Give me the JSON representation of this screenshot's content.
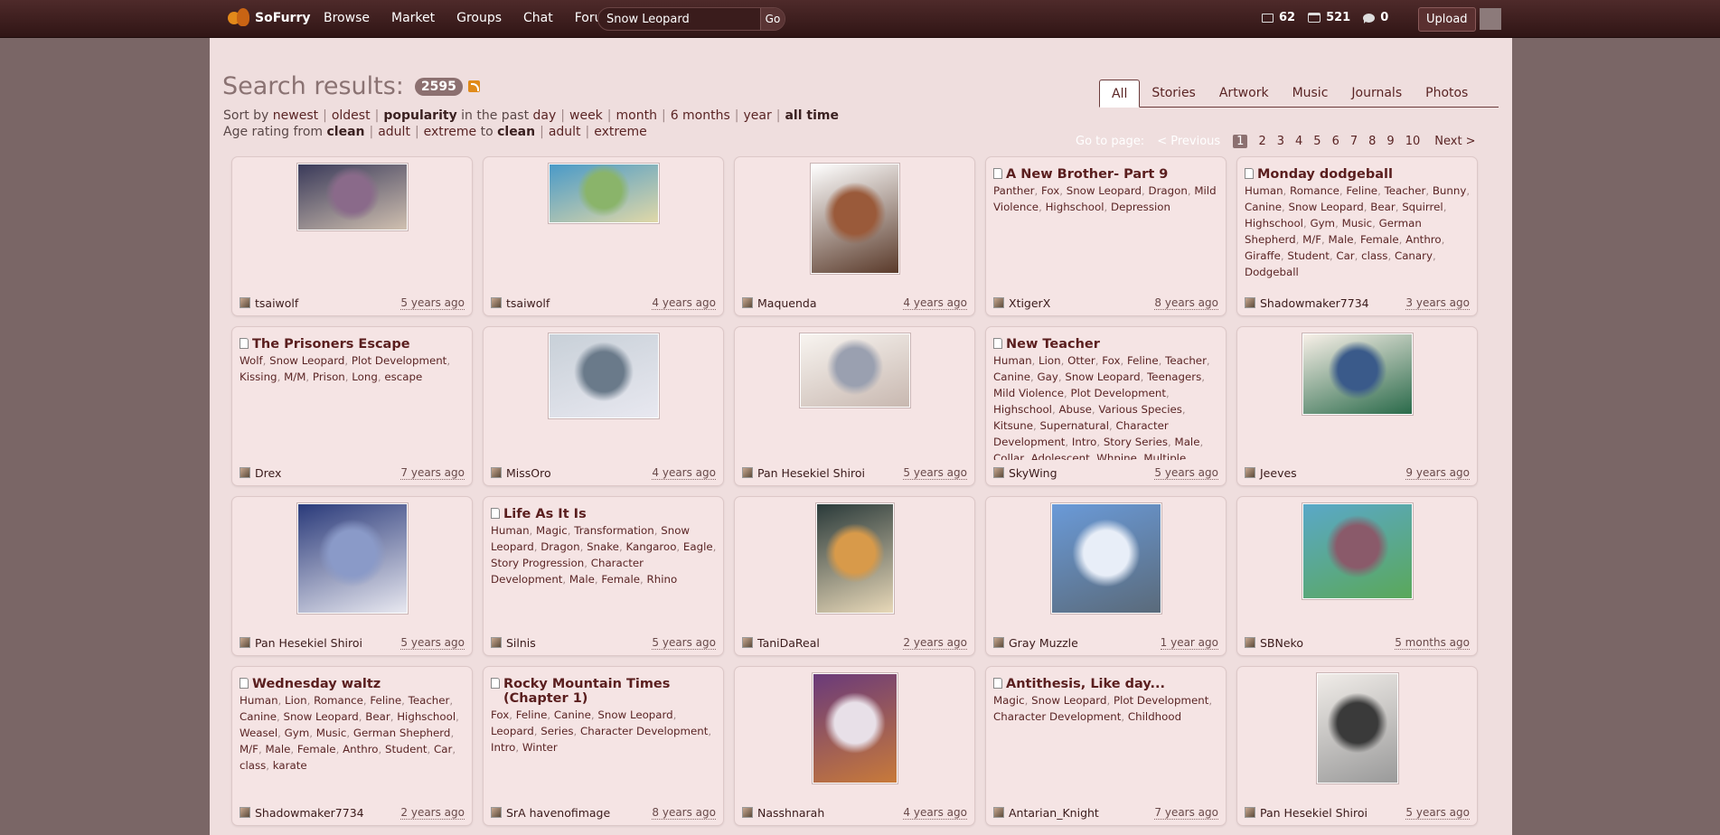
{
  "header": {
    "logo_text": "SoFurry",
    "nav": [
      "Browse",
      "Market",
      "Groups",
      "Chat",
      "Forum"
    ],
    "search_value": "Snow Leopard",
    "go_label": "Go",
    "stats": {
      "submissions": "62",
      "messages": "521",
      "comments": "0"
    },
    "upload_label": "Upload"
  },
  "search": {
    "title": "Search results:",
    "count": "2595"
  },
  "tabs": [
    "All",
    "Stories",
    "Artwork",
    "Music",
    "Journals",
    "Photos"
  ],
  "sort": {
    "prefix": "Sort by",
    "newest": "newest",
    "oldest": "oldest",
    "popularity": "popularity",
    "in_the_past": "in the past",
    "periods": [
      "day",
      "week",
      "month",
      "6 months",
      "year",
      "all time"
    ]
  },
  "age": {
    "prefix": "Age rating from",
    "from": [
      "clean",
      "adult",
      "extreme"
    ],
    "to_word": "to",
    "to": [
      "clean",
      "adult",
      "extreme"
    ]
  },
  "pager": {
    "label": "Go to page:",
    "prev": "< Previous",
    "pages": [
      "1",
      "2",
      "3",
      "4",
      "5",
      "6",
      "7",
      "8",
      "9",
      "10"
    ],
    "current": "1",
    "next": "Next >"
  },
  "results": [
    {
      "type": "art",
      "user": "tsaiwolf",
      "ago": "5 years ago",
      "tw": "124",
      "th": "76",
      "colors": [
        "#3a3a5a",
        "#8a6a8a",
        "#d0c0b0"
      ]
    },
    {
      "type": "art",
      "user": "tsaiwolf",
      "ago": "4 years ago",
      "tw": "124",
      "th": "68",
      "colors": [
        "#4a9ac8",
        "#8ab46a",
        "#e0d8a8"
      ]
    },
    {
      "type": "art",
      "user": "Maquenda",
      "ago": "4 years ago",
      "tw": "100",
      "th": "124",
      "colors": [
        "#ffffff",
        "#9a5a3a",
        "#5a3a2a"
      ]
    },
    {
      "type": "story",
      "title": "A New Brother- Part 9",
      "tags": [
        "Panther",
        "Fox",
        "Snow Leopard",
        "Dragon",
        "Mild Violence",
        "Highschool",
        "Depression"
      ],
      "user": "XtigerX",
      "ago": "8 years ago"
    },
    {
      "type": "story",
      "title": "Monday dodgeball",
      "tags": [
        "Human",
        "Romance",
        "Feline",
        "Teacher",
        "Bunny",
        "Canine",
        "Snow Leopard",
        "Bear",
        "Squirrel",
        "Highschool",
        "Gym",
        "Music",
        "German Shepherd",
        "M/F",
        "Male",
        "Female",
        "Anthro",
        "Giraffe",
        "Student",
        "Car",
        "class",
        "Canary",
        "Dodgeball"
      ],
      "user": "Shadowmaker7734",
      "ago": "3 years ago"
    },
    {
      "type": "story",
      "title": "The Prisoners Escape",
      "tags": [
        "Wolf",
        "Snow Leopard",
        "Plot Development",
        "Kissing",
        "M/M",
        "Prison",
        "Long",
        "escape"
      ],
      "user": "Drex",
      "ago": "7 years ago"
    },
    {
      "type": "art",
      "user": "MissOro",
      "ago": "4 years ago",
      "tw": "124",
      "th": "96",
      "colors": [
        "#c8d0d8",
        "#6a7a8a",
        "#e8e8f0"
      ]
    },
    {
      "type": "art",
      "user": "Pan Hesekiel Shiroi",
      "ago": "5 years ago",
      "tw": "124",
      "th": "84",
      "colors": [
        "#f8f4f0",
        "#9aa0b0",
        "#c8b8b0"
      ]
    },
    {
      "type": "story",
      "title": "New Teacher",
      "tags": [
        "Human",
        "Lion",
        "Otter",
        "Fox",
        "Feline",
        "Teacher",
        "Canine",
        "Gay",
        "Snow Leopard",
        "Teenagers",
        "Mild Violence",
        "Plot Development",
        "Highschool",
        "Abuse",
        "Various Species",
        "Kitsune",
        "Supernatural",
        "Character Development",
        "Intro",
        "Story Series",
        "Male",
        "Collar",
        "Adolescent",
        "Whpine",
        "Multiple"
      ],
      "user": "SkyWing",
      "ago": "5 years ago"
    },
    {
      "type": "art",
      "user": "Jeeves",
      "ago": "9 years ago",
      "tw": "124",
      "th": "92",
      "colors": [
        "#f8f0e8",
        "#3a5a8a",
        "#2a6a4a"
      ]
    },
    {
      "type": "art",
      "user": "Pan Hesekiel Shiroi",
      "ago": "5 years ago",
      "tw": "124",
      "th": "124",
      "colors": [
        "#2a3a7a",
        "#8a9ac8",
        "#e8e8f0"
      ]
    },
    {
      "type": "story",
      "title": "Life As It Is",
      "tags": [
        "Human",
        "Magic",
        "Transformation",
        "Snow Leopard",
        "Dragon",
        "Snake",
        "Kangaroo",
        "Eagle",
        "Story Progression",
        "Character Development",
        "Male",
        "Female",
        "Rhino"
      ],
      "user": "Silnis",
      "ago": "5 years ago"
    },
    {
      "type": "art",
      "user": "TaniDaReal",
      "ago": "2 years ago",
      "tw": "88",
      "th": "124",
      "colors": [
        "#2a3a3a",
        "#d89a4a",
        "#e8d8b8"
      ]
    },
    {
      "type": "art",
      "user": "Gray Muzzle",
      "ago": "1 year ago",
      "tw": "124",
      "th": "124",
      "colors": [
        "#6a9ad8",
        "#e8eef8",
        "#5a6a7a"
      ]
    },
    {
      "type": "art",
      "user": "SBNeko",
      "ago": "5 months ago",
      "tw": "124",
      "th": "108",
      "colors": [
        "#5aa8c8",
        "#8a5a6a",
        "#5aa85a"
      ]
    },
    {
      "type": "story",
      "title": "Wednesday waltz",
      "tags": [
        "Human",
        "Lion",
        "Romance",
        "Feline",
        "Teacher",
        "Canine",
        "Snow Leopard",
        "Bear",
        "Highschool",
        "Weasel",
        "Gym",
        "Music",
        "German Shepherd",
        "M/F",
        "Male",
        "Female",
        "Anthro",
        "Student",
        "Car",
        "class",
        "karate"
      ],
      "user": "Shadowmaker7734",
      "ago": "2 years ago"
    },
    {
      "type": "story",
      "title": "Rocky Mountain Times (Chapter 1)",
      "tags": [
        "Fox",
        "Feline",
        "Canine",
        "Snow Leopard",
        "Leopard",
        "Series",
        "Character Development",
        "Intro",
        "Winter"
      ],
      "user": "SrA havenofimage",
      "ago": "8 years ago"
    },
    {
      "type": "art",
      "user": "Nasshnarah",
      "ago": "4 years ago",
      "tw": "96",
      "th": "124",
      "colors": [
        "#6a3a7a",
        "#e8e0e8",
        "#c87a3a"
      ]
    },
    {
      "type": "story",
      "title": "Antithesis, Like day...",
      "tags": [
        "Magic",
        "Snow Leopard",
        "Plot Development",
        "Character Development",
        "Childhood"
      ],
      "user": "Antarian_Knight",
      "ago": "7 years ago"
    },
    {
      "type": "art",
      "user": "Pan Hesekiel Shiroi",
      "ago": "5 years ago",
      "tw": "92",
      "th": "124",
      "colors": [
        "#f0ece8",
        "#3a3a3a",
        "#9a9a9a"
      ]
    }
  ]
}
